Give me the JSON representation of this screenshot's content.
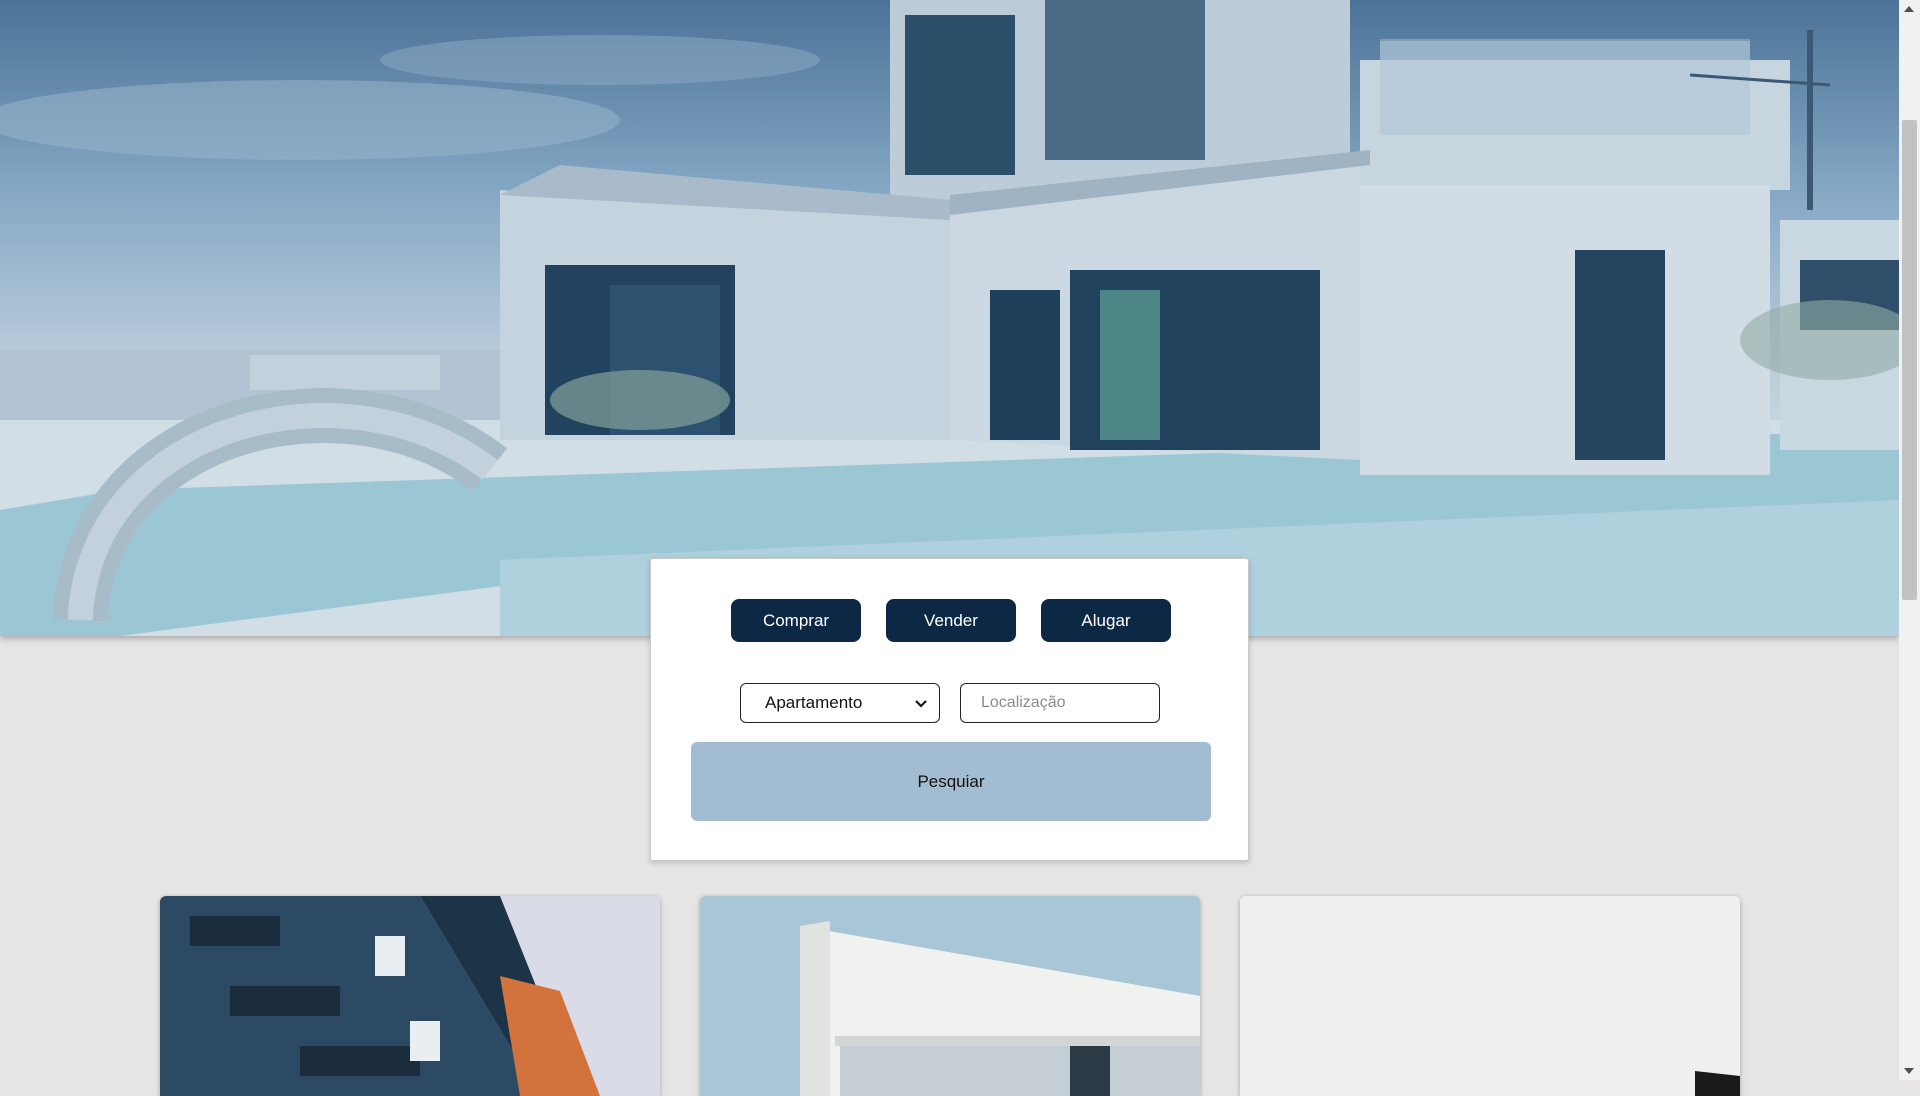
{
  "hero": {
    "image": "modern-villa-with-pool-photo"
  },
  "search": {
    "tabs": [
      {
        "label": "Comprar"
      },
      {
        "label": "Vender"
      },
      {
        "label": "Alugar"
      }
    ],
    "property_type": {
      "selected": "Apartamento"
    },
    "location": {
      "placeholder": "Localização",
      "value": ""
    },
    "submit_label": "Pesquiar"
  },
  "listings": [
    {
      "image": "blue-apartment-building-photo"
    },
    {
      "image": "white-modern-building-photo"
    },
    {
      "image": "white-wall-photo"
    }
  ],
  "colors": {
    "primary_button": "#0d2844",
    "search_button": "#a2bdd1",
    "page_background": "#e7e4e4"
  }
}
